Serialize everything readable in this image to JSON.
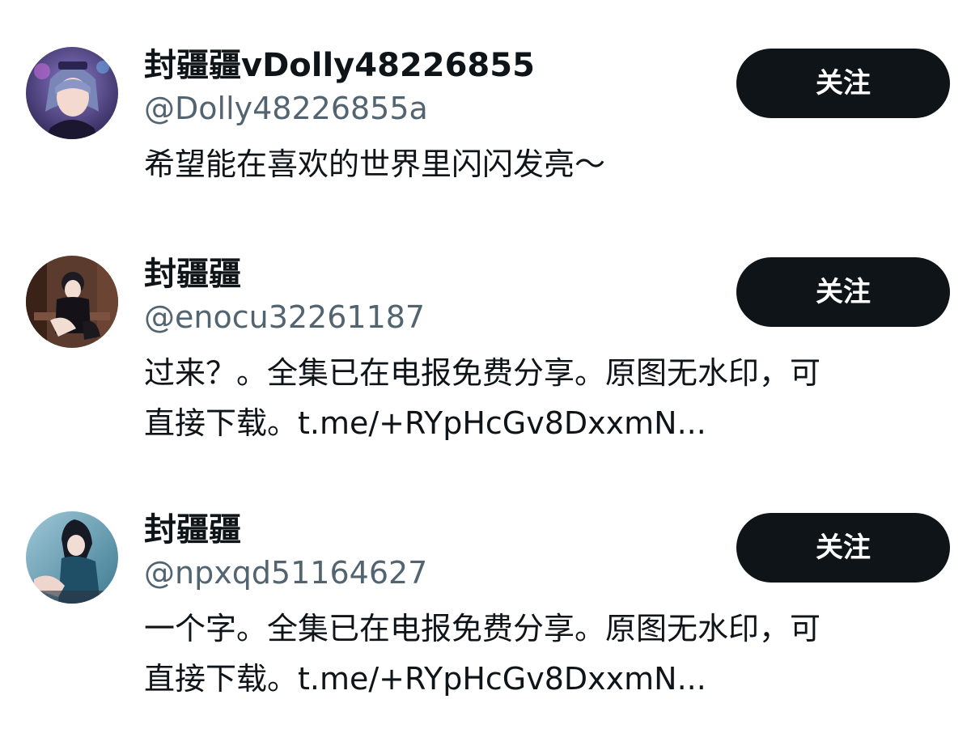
{
  "users": [
    {
      "display_name": "封疆疆vDolly48226855",
      "handle": "@Dolly48226855a",
      "bio_lines": [
        "希望能在喜欢的世界里闪闪发亮～"
      ],
      "follow_label": "关注"
    },
    {
      "display_name": "封疆疆",
      "handle": "@enocu32261187",
      "bio_lines": [
        "过来？。全集已在电报免费分享。原图无水印，可",
        "直接下载。t.me/+RYpHcGv8DxxmN..."
      ],
      "follow_label": "关注"
    },
    {
      "display_name": "封疆疆",
      "handle": "@npxqd51164627",
      "bio_lines": [
        "一个字。全集已在电报免费分享。原图无水印，可",
        "直接下载。t.me/+RYpHcGv8DxxmN..."
      ],
      "follow_label": "关注"
    }
  ],
  "colors": {
    "text_primary": "#0f1419",
    "text_secondary": "#536471",
    "button_bg": "#0f1419",
    "button_text": "#ffffff"
  }
}
